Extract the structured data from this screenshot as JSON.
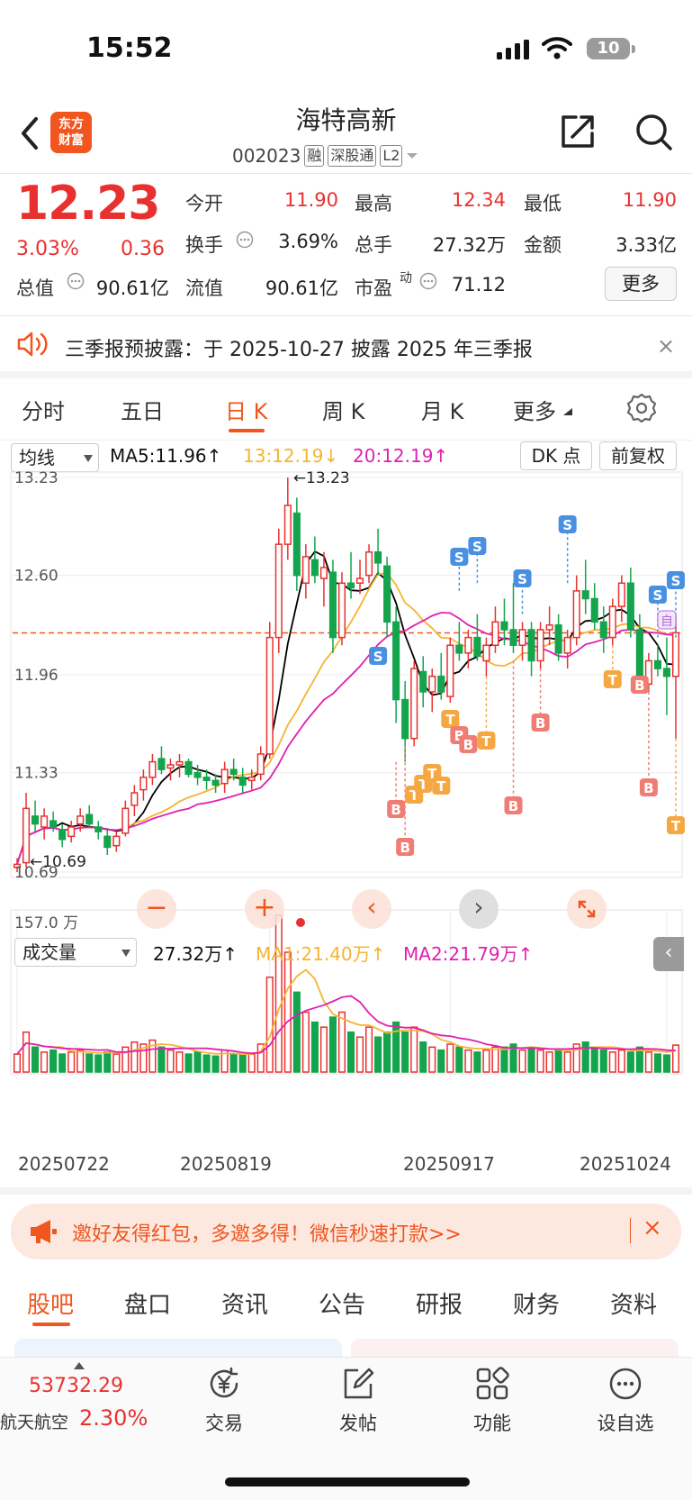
{
  "status": {
    "time": "15:52",
    "battery": "10"
  },
  "header": {
    "logo_line1": "东方",
    "logo_line2": "财富",
    "name": "海特高新",
    "code": "002023",
    "tags": [
      "融",
      "深股通",
      "L2"
    ]
  },
  "quote": {
    "price": "12.23",
    "pct": "3.03%",
    "change": "0.36",
    "fields": [
      {
        "label": "今开",
        "value": "11.90",
        "color": "red"
      },
      {
        "label": "最高",
        "value": "12.34",
        "color": "red"
      },
      {
        "label": "最低",
        "value": "11.90",
        "color": "red"
      },
      {
        "label": "换手",
        "value": "3.69%",
        "color": "black"
      },
      {
        "label": "总手",
        "value": "27.32万",
        "color": "black"
      },
      {
        "label": "金额",
        "value": "3.33亿",
        "color": "black"
      },
      {
        "label": "总值",
        "value": "90.61亿",
        "color": "black"
      },
      {
        "label": "流值",
        "value": "90.61亿",
        "color": "black"
      },
      {
        "label": "市盈",
        "label_sup": "动",
        "value": "71.12",
        "color": "black"
      }
    ],
    "more_label": "更多"
  },
  "notice": {
    "text": "三季报预披露：于 2025-10-27 披露 2025 年三季报",
    "close": "×"
  },
  "period_tabs": [
    "分时",
    "五日",
    "日 K",
    "周 K",
    "月 K",
    "更多"
  ],
  "ma_bar": {
    "selector": "均线",
    "ma5": "MA5:11.96",
    "ma13": "13:12.19",
    "ma20": "20:12.19",
    "dk": "DK 点",
    "adjust": "前复权"
  },
  "volume_bar": {
    "selector": "成交量",
    "vol": "27.32万",
    "ma1": "MA1:21.40万",
    "ma2": "MA2:21.79万"
  },
  "chart_data": {
    "type": "candlestick",
    "price_axis_labels": [
      "13.23",
      "12.60",
      "11.96",
      "11.33",
      "10.69"
    ],
    "ylim": [
      10.69,
      13.23
    ],
    "high_annotation": "←13.23",
    "low_annotation": "←10.69",
    "volume_axis_label": "157.0 万",
    "volume_max": 157.0,
    "dates": [
      "20250722",
      "20250819",
      "20250917",
      "20251024"
    ],
    "current_price_line": 12.23,
    "marker_labels": {
      "buy": "B",
      "sell": "S",
      "t": "T",
      "self": "自"
    },
    "candles": [
      [
        10.72,
        10.78,
        10.69,
        10.74,
        18
      ],
      [
        10.75,
        11.2,
        10.72,
        11.1,
        40
      ],
      [
        11.05,
        11.15,
        10.95,
        11.0,
        25
      ],
      [
        10.98,
        11.1,
        10.9,
        11.05,
        20
      ],
      [
        11.02,
        11.08,
        10.95,
        10.98,
        22
      ],
      [
        10.96,
        11.0,
        10.85,
        10.9,
        18
      ],
      [
        10.92,
        11.02,
        10.88,
        10.98,
        20
      ],
      [
        11.0,
        11.1,
        10.95,
        11.05,
        22
      ],
      [
        11.06,
        11.12,
        10.98,
        11.0,
        18
      ],
      [
        10.98,
        11.02,
        10.9,
        10.95,
        17
      ],
      [
        10.92,
        10.96,
        10.8,
        10.85,
        20
      ],
      [
        10.86,
        10.95,
        10.82,
        10.92,
        18
      ],
      [
        10.94,
        11.15,
        10.92,
        11.1,
        25
      ],
      [
        11.12,
        11.25,
        11.05,
        11.2,
        30
      ],
      [
        11.22,
        11.35,
        11.15,
        11.3,
        28
      ],
      [
        11.3,
        11.45,
        11.25,
        11.4,
        32
      ],
      [
        11.42,
        11.5,
        11.32,
        11.35,
        25
      ],
      [
        11.36,
        11.42,
        11.28,
        11.38,
        22
      ],
      [
        11.38,
        11.45,
        11.3,
        11.4,
        20
      ],
      [
        11.4,
        11.42,
        11.3,
        11.32,
        18
      ],
      [
        11.33,
        11.38,
        11.25,
        11.3,
        20
      ],
      [
        11.3,
        11.35,
        11.22,
        11.28,
        17
      ],
      [
        11.28,
        11.32,
        11.2,
        11.25,
        16
      ],
      [
        11.26,
        11.4,
        11.2,
        11.35,
        22
      ],
      [
        11.35,
        11.42,
        11.28,
        11.32,
        18
      ],
      [
        11.3,
        11.36,
        11.2,
        11.25,
        17
      ],
      [
        11.28,
        11.35,
        11.22,
        11.3,
        18
      ],
      [
        11.32,
        11.5,
        11.28,
        11.45,
        28
      ],
      [
        11.45,
        12.3,
        11.42,
        12.2,
        95
      ],
      [
        12.2,
        12.9,
        12.1,
        12.8,
        157
      ],
      [
        12.8,
        13.23,
        12.7,
        13.05,
        120
      ],
      [
        13.0,
        13.1,
        12.5,
        12.6,
        80
      ],
      [
        12.55,
        12.8,
        12.45,
        12.72,
        60
      ],
      [
        12.7,
        12.85,
        12.55,
        12.6,
        50
      ],
      [
        12.58,
        12.75,
        12.4,
        12.65,
        45
      ],
      [
        12.62,
        12.7,
        12.1,
        12.2,
        55
      ],
      [
        12.2,
        12.62,
        12.15,
        12.55,
        60
      ],
      [
        12.55,
        12.75,
        12.45,
        12.52,
        40
      ],
      [
        12.55,
        12.7,
        12.48,
        12.58,
        35
      ],
      [
        12.6,
        12.8,
        12.55,
        12.75,
        45
      ],
      [
        12.75,
        12.9,
        12.6,
        12.68,
        35
      ],
      [
        12.66,
        12.72,
        12.2,
        12.3,
        40
      ],
      [
        12.3,
        12.4,
        11.65,
        11.8,
        50
      ],
      [
        11.8,
        11.92,
        11.4,
        11.55,
        40
      ],
      [
        11.55,
        12.05,
        11.5,
        12.0,
        45
      ],
      [
        11.98,
        12.08,
        11.75,
        11.85,
        30
      ],
      [
        11.85,
        12.0,
        11.72,
        11.95,
        25
      ],
      [
        11.95,
        12.1,
        11.8,
        11.85,
        22
      ],
      [
        11.82,
        12.2,
        11.78,
        12.15,
        28
      ],
      [
        12.15,
        12.3,
        12.05,
        12.1,
        25
      ],
      [
        12.1,
        12.25,
        12.0,
        12.2,
        22
      ],
      [
        12.2,
        12.35,
        12.05,
        12.08,
        20
      ],
      [
        12.05,
        12.2,
        11.95,
        12.15,
        22
      ],
      [
        12.15,
        12.4,
        12.1,
        12.3,
        25
      ],
      [
        12.3,
        12.45,
        12.15,
        12.25,
        25
      ],
      [
        12.25,
        12.55,
        12.1,
        12.15,
        28
      ],
      [
        12.15,
        12.3,
        12.05,
        12.25,
        22
      ],
      [
        12.25,
        12.3,
        11.95,
        12.05,
        25
      ],
      [
        12.05,
        12.3,
        12.0,
        12.25,
        22
      ],
      [
        12.25,
        12.4,
        12.15,
        12.28,
        20
      ],
      [
        12.28,
        12.35,
        12.05,
        12.1,
        22
      ],
      [
        12.1,
        12.25,
        12.0,
        12.2,
        20
      ],
      [
        12.2,
        12.6,
        12.15,
        12.5,
        28
      ],
      [
        12.5,
        12.7,
        12.35,
        12.45,
        30
      ],
      [
        12.45,
        12.55,
        12.25,
        12.3,
        25
      ],
      [
        12.3,
        12.4,
        12.1,
        12.2,
        22
      ],
      [
        12.2,
        12.45,
        12.15,
        12.4,
        20
      ],
      [
        12.4,
        12.6,
        12.3,
        12.55,
        22
      ],
      [
        12.55,
        12.65,
        12.2,
        12.25,
        20
      ],
      [
        12.25,
        12.35,
        11.85,
        11.9,
        25
      ],
      [
        11.9,
        12.1,
        11.85,
        12.05,
        20
      ],
      [
        12.05,
        12.15,
        11.95,
        12.0,
        18
      ],
      [
        12.0,
        12.2,
        11.7,
        11.95,
        17
      ],
      [
        11.95,
        12.34,
        11.55,
        12.23,
        27
      ]
    ]
  },
  "promo": {
    "text": "邀好友得红包，多邀多得！微信秒速打款>>",
    "close": "×"
  },
  "sub_tabs": [
    "股吧",
    "盘口",
    "资讯",
    "公告",
    "研报",
    "财务",
    "资料"
  ],
  "bottom_bar": {
    "index_value": "53732.29",
    "index_name": "航天航空",
    "index_pct": "2.30%",
    "nav": [
      "交易",
      "发帖",
      "功能",
      "设自选"
    ]
  },
  "colors": {
    "up": "#e8312f",
    "down": "#14a44d",
    "accent": "#f0561e",
    "ma5": "#000000",
    "ma13": "#f6b431",
    "ma20": "#e020b0"
  }
}
